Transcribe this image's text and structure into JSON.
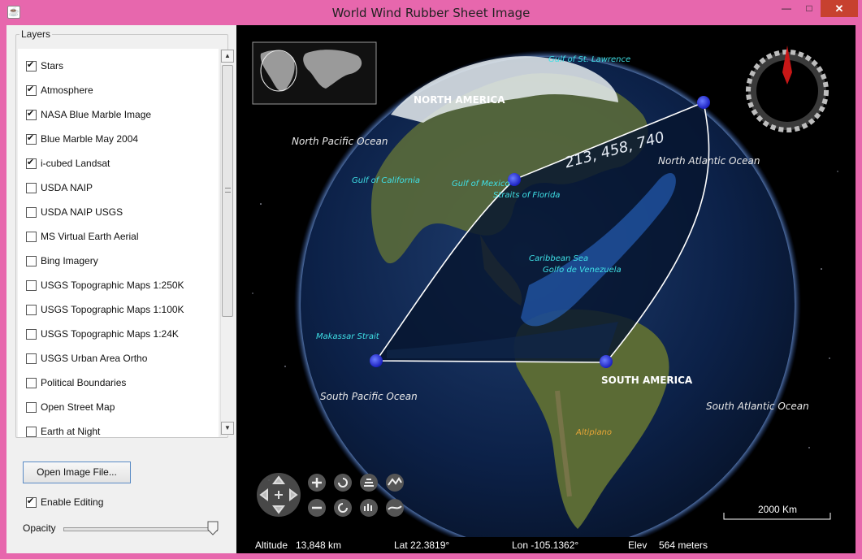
{
  "window": {
    "title": "World Wind Rubber Sheet Image",
    "min_icon": "minimize-icon",
    "max_icon": "maximize-icon",
    "close_icon": "close-icon",
    "min_glyph": "—",
    "max_glyph": "□",
    "close_glyph": "✕"
  },
  "layers": {
    "title": "Layers",
    "items": [
      {
        "label": "Stars",
        "checked": true
      },
      {
        "label": "Atmosphere",
        "checked": true
      },
      {
        "label": "NASA Blue Marble Image",
        "checked": true
      },
      {
        "label": "Blue Marble May 2004",
        "checked": true
      },
      {
        "label": "i-cubed Landsat",
        "checked": true
      },
      {
        "label": "USDA NAIP",
        "checked": false
      },
      {
        "label": "USDA NAIP USGS",
        "checked": false
      },
      {
        "label": "MS Virtual Earth Aerial",
        "checked": false
      },
      {
        "label": "Bing Imagery",
        "checked": false
      },
      {
        "label": "USGS Topographic Maps 1:250K",
        "checked": false
      },
      {
        "label": "USGS Topographic Maps 1:100K",
        "checked": false
      },
      {
        "label": "USGS Topographic Maps 1:24K",
        "checked": false
      },
      {
        "label": "USGS Urban Area Ortho",
        "checked": false
      },
      {
        "label": "Political Boundaries",
        "checked": false
      },
      {
        "label": "Open Street Map",
        "checked": false
      },
      {
        "label": "Earth at Night",
        "checked": false
      }
    ]
  },
  "controls": {
    "open_button": "Open Image File...",
    "enable_editing": "Enable Editing",
    "enable_editing_checked": true,
    "opacity_label": "Opacity",
    "opacity_value": 1.0
  },
  "map": {
    "regions": [
      "NORTH AMERICA",
      "SOUTH AMERICA"
    ],
    "oceans": [
      "North Pacific Ocean",
      "North Atlantic Ocean",
      "South Pacific Ocean",
      "South Atlantic Ocean"
    ],
    "places": [
      "Gulf of St. Lawrence",
      "Gulf of California",
      "Gulf of Mexico",
      "Straits of Florida",
      "Caribbean Sea",
      "Golfo de Venezuela",
      "Makassar Strait",
      "Altiplano"
    ],
    "image_number": "213, 458, 740",
    "scale": "2000 Km"
  },
  "status": {
    "altitude_label": "Altitude",
    "altitude_value": "13,848 km",
    "lat": "Lat 22.3819°",
    "lon": "Lon -105.1362°",
    "elev_label": "Elev",
    "elev_value": "564 meters"
  },
  "icons": [
    "compass-icon",
    "pan-icon",
    "zoom-in-icon",
    "zoom-out-icon",
    "rotate-left-icon",
    "rotate-right-icon",
    "tilt-up-icon",
    "tilt-down-icon",
    "exaggeration-up-icon",
    "exaggeration-down-icon",
    "world-map-icon"
  ]
}
